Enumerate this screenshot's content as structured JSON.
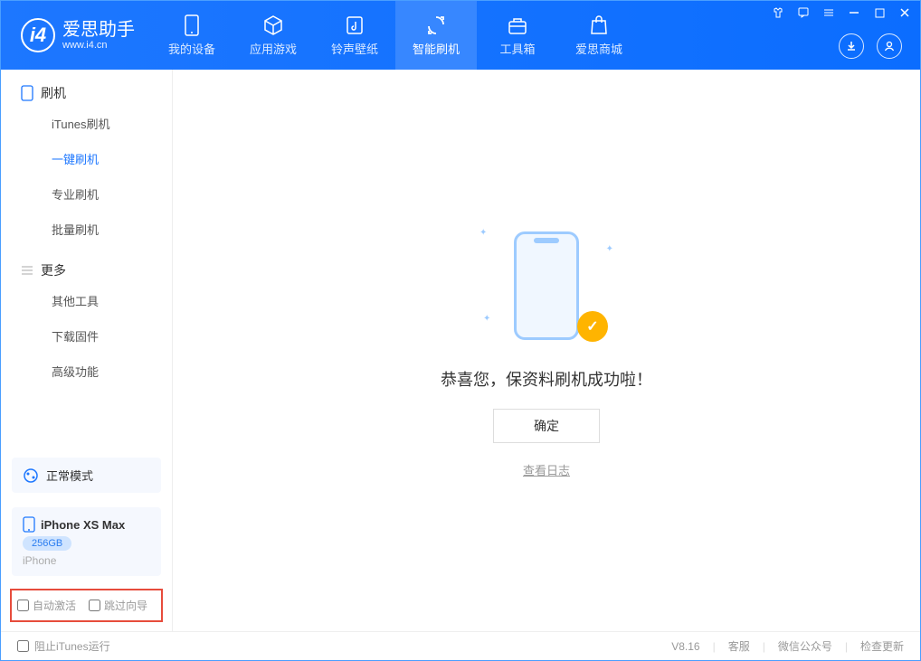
{
  "brand": {
    "name": "爱思助手",
    "sub": "www.i4.cn"
  },
  "nav": {
    "tabs": [
      {
        "label": "我的设备"
      },
      {
        "label": "应用游戏"
      },
      {
        "label": "铃声壁纸"
      },
      {
        "label": "智能刷机"
      },
      {
        "label": "工具箱"
      },
      {
        "label": "爱思商城"
      }
    ]
  },
  "sidebar": {
    "group1": "刷机",
    "items1": [
      {
        "label": "iTunes刷机"
      },
      {
        "label": "一键刷机"
      },
      {
        "label": "专业刷机"
      },
      {
        "label": "批量刷机"
      }
    ],
    "group2": "更多",
    "items2": [
      {
        "label": "其他工具"
      },
      {
        "label": "下载固件"
      },
      {
        "label": "高级功能"
      }
    ],
    "mode": "正常模式",
    "device": {
      "name": "iPhone XS Max",
      "capacity": "256GB",
      "type": "iPhone"
    },
    "opts": {
      "auto_activate": "自动激活",
      "skip_guide": "跳过向导"
    }
  },
  "main": {
    "success": "恭喜您，保资料刷机成功啦！",
    "ok": "确定",
    "view_log": "查看日志"
  },
  "footer": {
    "block_itunes": "阻止iTunes运行",
    "version": "V8.16",
    "links": {
      "support": "客服",
      "wechat": "微信公众号",
      "update": "检查更新"
    }
  }
}
